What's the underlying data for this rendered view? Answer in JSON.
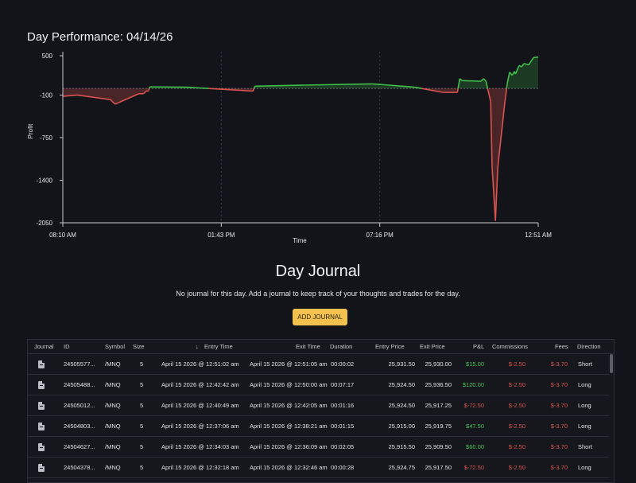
{
  "page": {
    "title": "Day Performance: 04/14/26"
  },
  "chart_data": {
    "type": "area",
    "title": "Day Performance: 04/14/26",
    "xlabel": "Time",
    "ylabel": "Profit",
    "y_ticks": [
      "500",
      "-100",
      "-750",
      "-1400",
      "-2050"
    ],
    "y_tick_values": [
      500,
      -100,
      -750,
      -1400,
      -2050
    ],
    "ylim": [
      -2050,
      500
    ],
    "x_ticks": [
      "08:10 AM",
      "01:43 PM",
      "07:16 PM",
      "12:51 AM"
    ],
    "grid": "vertical dashed",
    "baseline": 0,
    "colors": {
      "positive": "#3fbf4a",
      "negative": "#d9534f"
    },
    "series": [
      {
        "x": [
          0,
          0.03,
          0.1,
          0.11,
          0.16,
          0.17,
          0.175,
          0.18,
          0.183,
          0.26,
          0.4,
          0.404,
          0.5,
          0.65,
          0.67,
          0.74,
          0.8,
          0.83,
          0.835,
          0.84,
          0.88,
          0.885,
          0.89,
          0.9,
          0.903,
          0.91,
          0.915,
          0.93,
          0.935,
          0.94,
          0.945,
          0.95,
          0.952,
          0.96,
          0.965,
          0.97,
          0.98,
          0.99,
          1.0
        ],
        "y": [
          -120,
          -100,
          -170,
          -240,
          -80,
          -80,
          -40,
          -40,
          25,
          20,
          -40,
          35,
          50,
          70,
          60,
          20,
          -60,
          -60,
          150,
          120,
          110,
          150,
          110,
          -200,
          -1200,
          -2020,
          -1200,
          -200,
          80,
          250,
          200,
          260,
          220,
          350,
          330,
          380,
          360,
          470,
          480
        ]
      }
    ]
  },
  "journal": {
    "title": "Day Journal",
    "message": "No journal for this day. Add a journal to keep track of your thoughts and trades for the day.",
    "add_button": "ADD JOURNAL"
  },
  "table": {
    "headers": {
      "journal": "Journal",
      "id": "ID",
      "symbol": "Symbol",
      "size": "Size",
      "entry_time": "Entry Time",
      "exit_time": "Exit Time",
      "duration": "Duration",
      "entry_price": "Entry Price",
      "exit_price": "Exit Price",
      "pnl": "P&L",
      "commissions": "Commissions",
      "fees": "Fees",
      "direction": "Direction"
    },
    "rows": [
      {
        "id": "24505577...",
        "symbol": "/MNQ",
        "size": "5",
        "entry_time": "April 15 2026 @ 12:51:02 am",
        "exit_time": "April 15 2026 @ 12:51:05 am",
        "duration": "00:00:02",
        "entry_price": "25,931.50",
        "exit_price": "25,930.00",
        "pnl": "$15.00",
        "commissions": "$-2.50",
        "fees": "$-3.70",
        "direction": "Short"
      },
      {
        "id": "24505488...",
        "symbol": "/MNQ",
        "size": "5",
        "entry_time": "April 15 2026 @ 12:42:42 am",
        "exit_time": "April 15 2026 @ 12:50:00 am",
        "duration": "00:07:17",
        "entry_price": "25,924.50",
        "exit_price": "25,936.50",
        "pnl": "$120.00",
        "commissions": "$-2.50",
        "fees": "$-3.70",
        "direction": "Long"
      },
      {
        "id": "24505012...",
        "symbol": "/MNQ",
        "size": "5",
        "entry_time": "April 15 2026 @ 12:40:49 am",
        "exit_time": "April 15 2026 @ 12:42:05 am",
        "duration": "00:01:16",
        "entry_price": "25,924.50",
        "exit_price": "25,917.25",
        "pnl": "$-72.50",
        "commissions": "$-2.50",
        "fees": "$-3.70",
        "direction": "Long"
      },
      {
        "id": "24504803...",
        "symbol": "/MNQ",
        "size": "5",
        "entry_time": "April 15 2026 @ 12:37:06 am",
        "exit_time": "April 15 2026 @ 12:38:21 am",
        "duration": "00:01:15",
        "entry_price": "25,915.00",
        "exit_price": "25,919.75",
        "pnl": "$47.50",
        "commissions": "$-2.50",
        "fees": "$-3.70",
        "direction": "Long"
      },
      {
        "id": "24504627...",
        "symbol": "/MNQ",
        "size": "5",
        "entry_time": "April 15 2026 @ 12:34:03 am",
        "exit_time": "April 15 2026 @ 12:36:09 am",
        "duration": "00:02:05",
        "entry_price": "25,915.50",
        "exit_price": "25,909.50",
        "pnl": "$60.00",
        "commissions": "$-2.50",
        "fees": "$-3.70",
        "direction": "Short"
      },
      {
        "id": "24504378...",
        "symbol": "/MNQ",
        "size": "5",
        "entry_time": "April 15 2026 @ 12:32:18 am",
        "exit_time": "April 15 2026 @ 12:32:46 am",
        "duration": "00:00:28",
        "entry_price": "25,924.75",
        "exit_price": "25,917.50",
        "pnl": "$-72.50",
        "commissions": "$-2.50",
        "fees": "$-3.70",
        "direction": "Long"
      }
    ]
  }
}
